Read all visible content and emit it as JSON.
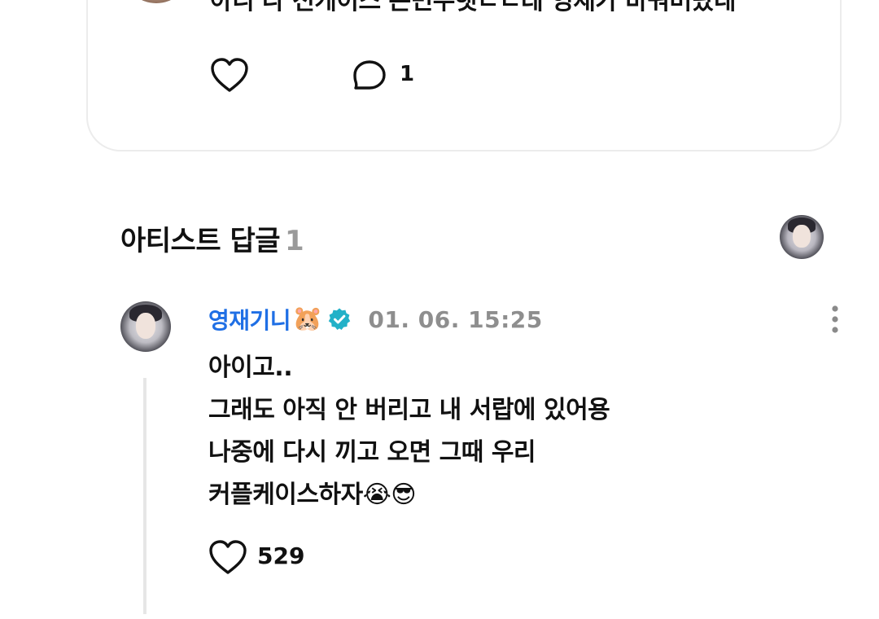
{
  "post": {
    "text": "아니 나 전케이스 손민수햇ㄴㄴ데 영재가 바꿔버랐네",
    "comment_count": "1"
  },
  "artist_replies": {
    "title": "아티스트 답글",
    "count": "1"
  },
  "reply": {
    "author": "영재기니",
    "author_emoji": "🐹",
    "timestamp": "01. 06. 15:25",
    "lines": [
      "아이고..",
      "그래도 아직 안 버리고 내 서랍에 있어용",
      "나중에 다시 끼고 오면 그때 우리",
      "커플케이스하자😭😎"
    ],
    "like_count": "529"
  },
  "colors": {
    "author_blue": "#1f6fe5",
    "verified_teal": "#22b1c8",
    "muted_gray": "#8e8e8e",
    "divider": "#e6e6e6"
  },
  "icons": {
    "like": "heart-icon",
    "comment": "speech-bubble-icon",
    "verified": "verified-badge-icon",
    "menu": "kebab-menu-icon"
  }
}
